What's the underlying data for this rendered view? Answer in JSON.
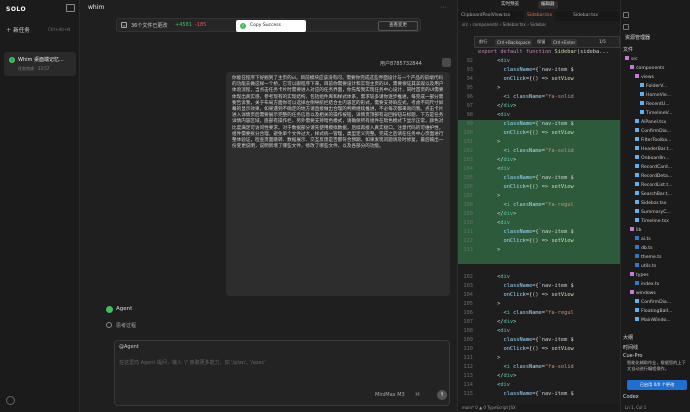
{
  "app": {
    "logo": "SOLO",
    "new_task": "新任务",
    "new_task_kbd": "Ctrl+Alt+N"
  },
  "task": {
    "title": "Whim 桌面端记忆...",
    "subtitle": "任务完成 · 13:57"
  },
  "chat": {
    "header_title": "whim",
    "diff": {
      "summary": "36个文件已更改",
      "added": "+4581",
      "removed": "-185"
    },
    "copy_toast": "Copy Success",
    "view_changes": "查看变更",
    "user_id": "用户8785732844",
    "message": "你能在程序下好掘到了主页的ui，目前模块应该没有问，需要你完成这些界面设计与一个产品的前端代码的功能去做这样一个桥，它可以跟程序下来，目前你需要设计和实现主页的UI，需要保证其美观以及用户体验流程，当点击任务卡片时需要进入对应的任务界面，你先帮我实现任务中心设计，同时首页的UI需要体现出真实感，参考现有的实现结构，包括组件库和样式体系，需求较多请你逐步推进，每完成一部分需要告诉我，关于布局方面你可以选择左侧导航栏结合主内容区的形式，需要支持响应式，考虑不同尺寸屏幕的显示效果，如果遇到不确定的地方请直接做出合理的判断继续推进，不必每次都来询问我。点击卡片进入详情页后需要展示完整的任务信息以及相关的操作按钮，详情页顶部有返回按钮与标题，下方是任务详情内容区域，底部有操作栏，另外需要支持暗色模式，请确保所有组件在暗色模式下显示正常，颜色对比度满足可访问性要求。对于数据部分请先使用模拟数据，后续再接入真实接口。注意代码的可维护性，组件需要拆分合理，避免单个文件过大，样式统一管理，类型定义完整。完成之后请在任务中心页面进行整体验证，检查页面跳转、数据展示、交互反馈是否都符合预期，如果发现问题请及时修复。最后输出一份变更说明，说明新增了哪些文件，修改了哪些文件，以及各部分的功能。"
  },
  "agent": {
    "label": "Agent",
    "think": "思考过程"
  },
  "input": {
    "mention": "@Agent",
    "placeholder": "在这里向 Agent 提问，输入 '/' 获取更多能力，如 '/plan', '/spec'",
    "model": "MiniMax M3"
  },
  "editor": {
    "toolbar": {
      "realtime": "实时预览",
      "code": "编辑器"
    },
    "tabs": [
      "ClipboardPoolView.tsx",
      "Sidebar.tsx",
      "Sidebar.tsx"
    ],
    "crumbs": "src › components › Sidebar.tsx › Sidebar",
    "find": {
      "prev": "前行",
      "prev_kbd": "Ctrl+Backspace",
      "keep": "保留",
      "keep_kbd": "Ctrl+Enter",
      "count": "1/5"
    },
    "lines": [
      {
        "n": "",
        "hl": false,
        "tokens": [
          [
            "kw",
            "export default function "
          ],
          [
            "fn",
            "Sidebar"
          ],
          [
            "pun",
            "(sideba..."
          ]
        ]
      },
      {
        "n": "92",
        "hl": false,
        "tokens": [
          [
            "pun",
            "      <"
          ],
          [
            "tag",
            "div"
          ]
        ]
      },
      {
        "n": "93",
        "hl": false,
        "tokens": [
          [
            "attr",
            "        className"
          ],
          [
            "pun",
            "={`nav-item $"
          ]
        ]
      },
      {
        "n": "94",
        "hl": false,
        "tokens": [
          [
            "attr",
            "        onClick"
          ],
          [
            "pun",
            "={() => "
          ],
          [
            "fn",
            "setView"
          ]
        ]
      },
      {
        "n": "95",
        "hl": false,
        "tokens": [
          [
            "pun",
            "      >"
          ]
        ]
      },
      {
        "n": "96",
        "hl": false,
        "tokens": [
          [
            "pun",
            "        <"
          ],
          [
            "tag",
            "i "
          ],
          [
            "attr",
            "className"
          ],
          [
            "pun",
            "="
          ],
          [
            "str",
            "\"fa-solid"
          ]
        ]
      },
      {
        "n": "97",
        "hl": false,
        "tokens": [
          [
            "pun",
            "      </"
          ],
          [
            "tag",
            "div"
          ],
          [
            "pun",
            ">"
          ]
        ]
      },
      {
        "n": "98",
        "hl": false,
        "tokens": [
          [
            "pun",
            "      <"
          ],
          [
            "tag",
            "div"
          ]
        ]
      },
      {
        "n": "99",
        "hl": true,
        "tokens": [
          [
            "attr",
            "        className"
          ],
          [
            "pun",
            "={`nav-item $"
          ]
        ]
      },
      {
        "n": "100",
        "hl": true,
        "tokens": [
          [
            "attr",
            "        onClick"
          ],
          [
            "pun",
            "={() => "
          ],
          [
            "fn",
            "setView"
          ]
        ]
      },
      {
        "n": "101",
        "hl": true,
        "tokens": [
          [
            "pun",
            "      >"
          ]
        ]
      },
      {
        "n": "102",
        "hl": true,
        "tokens": [
          [
            "pun",
            "        <"
          ],
          [
            "tag",
            "i "
          ],
          [
            "attr",
            "className"
          ],
          [
            "pun",
            "="
          ],
          [
            "str",
            "\"fa-solid"
          ]
        ]
      },
      {
        "n": "103",
        "hl": true,
        "tokens": [
          [
            "pun",
            "      </"
          ],
          [
            "tag",
            "div"
          ],
          [
            "pun",
            ">"
          ]
        ]
      },
      {
        "n": "104",
        "hl": true,
        "tokens": [
          [
            "pun",
            "      <"
          ],
          [
            "tag",
            "div"
          ]
        ]
      },
      {
        "n": "105",
        "hl": true,
        "tokens": [
          [
            "attr",
            "        className"
          ],
          [
            "pun",
            "={`nav-item $"
          ]
        ]
      },
      {
        "n": "106",
        "hl": true,
        "tokens": [
          [
            "attr",
            "        onClick"
          ],
          [
            "pun",
            "={() => "
          ],
          [
            "fn",
            "setView"
          ]
        ]
      },
      {
        "n": "107",
        "hl": true,
        "tokens": [
          [
            "pun",
            "      >"
          ]
        ]
      },
      {
        "n": "108",
        "hl": true,
        "tokens": [
          [
            "pun",
            "        <"
          ],
          [
            "tag",
            "i "
          ],
          [
            "attr",
            "className"
          ],
          [
            "pun",
            "="
          ],
          [
            "str",
            "\"fa-regul"
          ]
        ]
      },
      {
        "n": "109",
        "hl": true,
        "tokens": [
          [
            "pun",
            "      </"
          ],
          [
            "tag",
            "div"
          ],
          [
            "pun",
            ">"
          ]
        ]
      },
      {
        "n": "110",
        "hl": true,
        "tokens": [
          [
            "pun",
            "      <"
          ],
          [
            "tag",
            "div"
          ]
        ]
      },
      {
        "n": "111",
        "hl": true,
        "tokens": [
          [
            "attr",
            "        className"
          ],
          [
            "pun",
            "={`nav-item $"
          ]
        ]
      },
      {
        "n": "112",
        "hl": true,
        "tokens": [
          [
            "attr",
            "        onClick"
          ],
          [
            "pun",
            "={() => "
          ],
          [
            "fn",
            "setView"
          ]
        ]
      },
      {
        "n": "113",
        "hl": true,
        "tokens": [
          [
            "pun",
            "      >"
          ]
        ]
      },
      {
        "n": "",
        "hl": true,
        "tokens": [
          [
            "pun",
            ""
          ]
        ]
      },
      {
        "n": "",
        "hl": false,
        "tokens": [
          [
            "pun",
            ""
          ]
        ]
      },
      {
        "n": "102",
        "hl": false,
        "tokens": [
          [
            "pun",
            "      <"
          ],
          [
            "tag",
            "div"
          ]
        ]
      },
      {
        "n": "103",
        "hl": false,
        "tokens": [
          [
            "attr",
            "        className"
          ],
          [
            "pun",
            "={`nav-item $"
          ]
        ]
      },
      {
        "n": "104",
        "hl": false,
        "tokens": [
          [
            "attr",
            "        onClick"
          ],
          [
            "pun",
            "={() => "
          ],
          [
            "fn",
            "setView"
          ]
        ]
      },
      {
        "n": "105",
        "hl": false,
        "tokens": [
          [
            "pun",
            "      >"
          ]
        ]
      },
      {
        "n": "106",
        "hl": false,
        "tokens": [
          [
            "pun",
            "        <"
          ],
          [
            "tag",
            "i "
          ],
          [
            "attr",
            "className"
          ],
          [
            "pun",
            "="
          ],
          [
            "str",
            "\"fa-regul"
          ]
        ]
      },
      {
        "n": "107",
        "hl": false,
        "tokens": [
          [
            "pun",
            "      </"
          ],
          [
            "tag",
            "div"
          ],
          [
            "pun",
            ">"
          ]
        ]
      },
      {
        "n": "108",
        "hl": false,
        "tokens": [
          [
            "pun",
            "      <"
          ],
          [
            "tag",
            "div"
          ]
        ]
      },
      {
        "n": "109",
        "hl": false,
        "tokens": [
          [
            "attr",
            "        className"
          ],
          [
            "pun",
            "={`nav-item $"
          ]
        ]
      },
      {
        "n": "110",
        "hl": false,
        "tokens": [
          [
            "attr",
            "        onClick"
          ],
          [
            "pun",
            "={() => "
          ],
          [
            "fn",
            "setView"
          ]
        ]
      },
      {
        "n": "111",
        "hl": false,
        "tokens": [
          [
            "pun",
            "      >"
          ]
        ]
      },
      {
        "n": "112",
        "hl": false,
        "tokens": [
          [
            "pun",
            "        <"
          ],
          [
            "tag",
            "i "
          ],
          [
            "attr",
            "className"
          ],
          [
            "pun",
            "="
          ],
          [
            "str",
            "\"fa-solid"
          ]
        ]
      },
      {
        "n": "113",
        "hl": false,
        "tokens": [
          [
            "pun",
            "      </"
          ],
          [
            "tag",
            "div"
          ],
          [
            "pun",
            ">"
          ]
        ]
      },
      {
        "n": "114",
        "hl": false,
        "tokens": [
          [
            "pun",
            "      <"
          ],
          [
            "tag",
            "div"
          ]
        ]
      },
      {
        "n": "115",
        "hl": false,
        "tokens": [
          [
            "attr",
            "        className"
          ],
          [
            "pun",
            "={`nav-item $"
          ]
        ]
      }
    ],
    "status": "main*  0 ▲ 0  TypeScript JSX"
  },
  "explorer": {
    "title": "资源管理器",
    "section": "文件",
    "items": [
      {
        "indent": 0,
        "label": "src",
        "color": "#c678dd"
      },
      {
        "indent": 1,
        "label": "components",
        "color": "#c678dd"
      },
      {
        "indent": 2,
        "label": "views",
        "color": "#c678dd"
      },
      {
        "indent": 3,
        "label": "FolderV...",
        "color": "#61afef"
      },
      {
        "indent": 3,
        "label": "HomeVie...",
        "color": "#61afef"
      },
      {
        "indent": 3,
        "label": "RecentU...",
        "color": "#61afef"
      },
      {
        "indent": 3,
        "label": "TimelineV...",
        "color": "#61afef"
      },
      {
        "indent": 2,
        "label": "AiPanel.tsx",
        "color": "#61afef"
      },
      {
        "indent": 2,
        "label": "ConfirmDia...",
        "color": "#61afef"
      },
      {
        "indent": 2,
        "label": "FilterToolba...",
        "color": "#61afef"
      },
      {
        "indent": 2,
        "label": "HeaderBar.t...",
        "color": "#61afef"
      },
      {
        "indent": 2,
        "label": "OnboardIn...",
        "color": "#61afef"
      },
      {
        "indent": 2,
        "label": "RecordCard...",
        "color": "#61afef"
      },
      {
        "indent": 2,
        "label": "RecordDeta...",
        "color": "#61afef"
      },
      {
        "indent": 2,
        "label": "RecordList.t...",
        "color": "#61afef"
      },
      {
        "indent": 2,
        "label": "SearchBar.t...",
        "color": "#61afef"
      },
      {
        "indent": 2,
        "label": "Sidebar.tsx",
        "color": "#61afef"
      },
      {
        "indent": 2,
        "label": "SummaryC...",
        "color": "#61afef"
      },
      {
        "indent": 2,
        "label": "Timeline.tsx",
        "color": "#61afef"
      },
      {
        "indent": 1,
        "label": "lib",
        "color": "#c678dd"
      },
      {
        "indent": 2,
        "label": "ai.ts",
        "color": "#3178c6"
      },
      {
        "indent": 2,
        "label": "db.ts",
        "color": "#3178c6"
      },
      {
        "indent": 2,
        "label": "theme.ts",
        "color": "#3178c6"
      },
      {
        "indent": 2,
        "label": "utils.ts",
        "color": "#3178c6"
      },
      {
        "indent": 1,
        "label": "types",
        "color": "#c678dd"
      },
      {
        "indent": 2,
        "label": "index.ts",
        "color": "#3178c6"
      },
      {
        "indent": 1,
        "label": "windows",
        "color": "#c678dd"
      },
      {
        "indent": 2,
        "label": "ConfirmDia...",
        "color": "#61afef"
      },
      {
        "indent": 2,
        "label": "FloatingBall...",
        "color": "#61afef"
      },
      {
        "indent": 2,
        "label": "MainWindo...",
        "color": "#61afef"
      }
    ],
    "sections2": [
      "大纲",
      "时间线"
    ],
    "cue_title": "Cue-Pro",
    "cue_text": "智能化辅助作业，根据您的上下文自动进行编程操作。",
    "cue_btn": "已启用 0/0 个更改",
    "codex": "Codex",
    "status": "Ln 1, Col 1"
  },
  "colors": {
    "accent_green": "#3fbf5e",
    "removed_red": "#e05555",
    "diff_highlight": "#2c5a3a"
  }
}
